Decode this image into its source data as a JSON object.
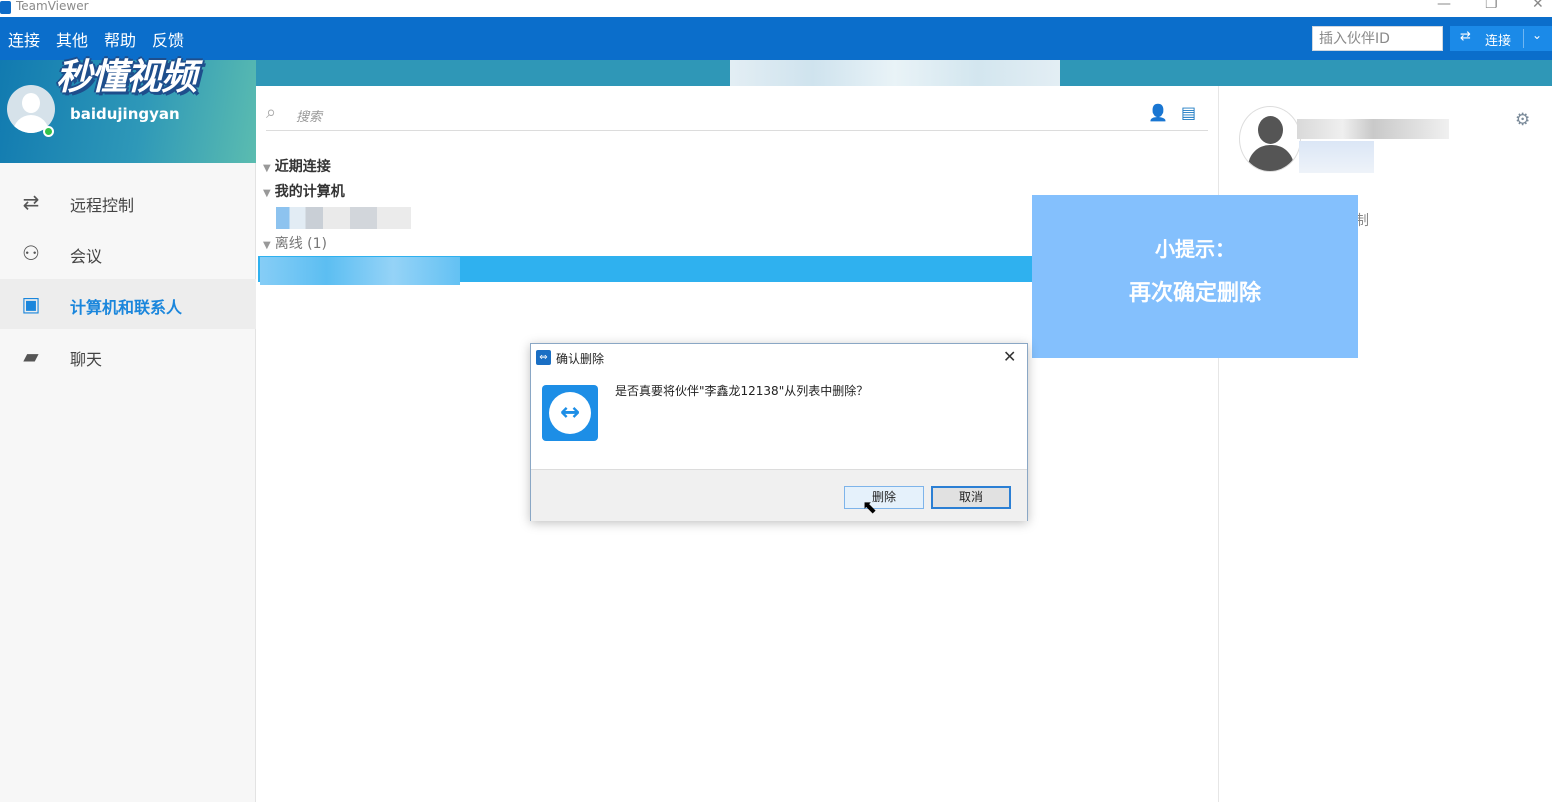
{
  "window": {
    "title": "TeamViewer",
    "minimize_glyph": "—",
    "maximize_glyph": "❐",
    "close_glyph": "✕"
  },
  "menu": [
    "连接",
    "其他",
    "帮助",
    "反馈"
  ],
  "toolbar": {
    "partner_id_placeholder": "插入伙伴ID",
    "connect_label": "连接",
    "connect_icon": "⇄",
    "dropdown_icon": "⌄"
  },
  "watermark": {
    "text": "秒懂视频"
  },
  "profile": {
    "username": "baidujingyan"
  },
  "sidebar": {
    "items": [
      {
        "label": "远程控制",
        "icon": "⇄"
      },
      {
        "label": "会议",
        "icon": "⚇"
      },
      {
        "label": "计算机和联系人",
        "icon": "▣"
      },
      {
        "label": "聊天",
        "icon": "▰"
      }
    ]
  },
  "main": {
    "search_placeholder": "搜索",
    "search_icon": "⌕",
    "add_contact_icon": "👤",
    "view_icon": "▤",
    "groups": {
      "recent": "近期连接",
      "my_computers": "我的计算机",
      "offline": "离线 (1)"
    }
  },
  "right_panel": {
    "gear_icon": "⚙",
    "partial_text": "制"
  },
  "tip": {
    "title": "小提示：",
    "body": "再次确定删除"
  },
  "dialog": {
    "title": "确认删除",
    "message": "是否真要将伙伴\"李鑫龙12138\"从列表中删除？",
    "close_glyph": "✕",
    "delete_label": "删除",
    "cancel_label": "取消"
  },
  "colors": {
    "header_blue": "#0b6ecb",
    "accent": "#1a86dc",
    "selected_row": "#2fb1ef",
    "tip_box": "#84c0fd"
  }
}
